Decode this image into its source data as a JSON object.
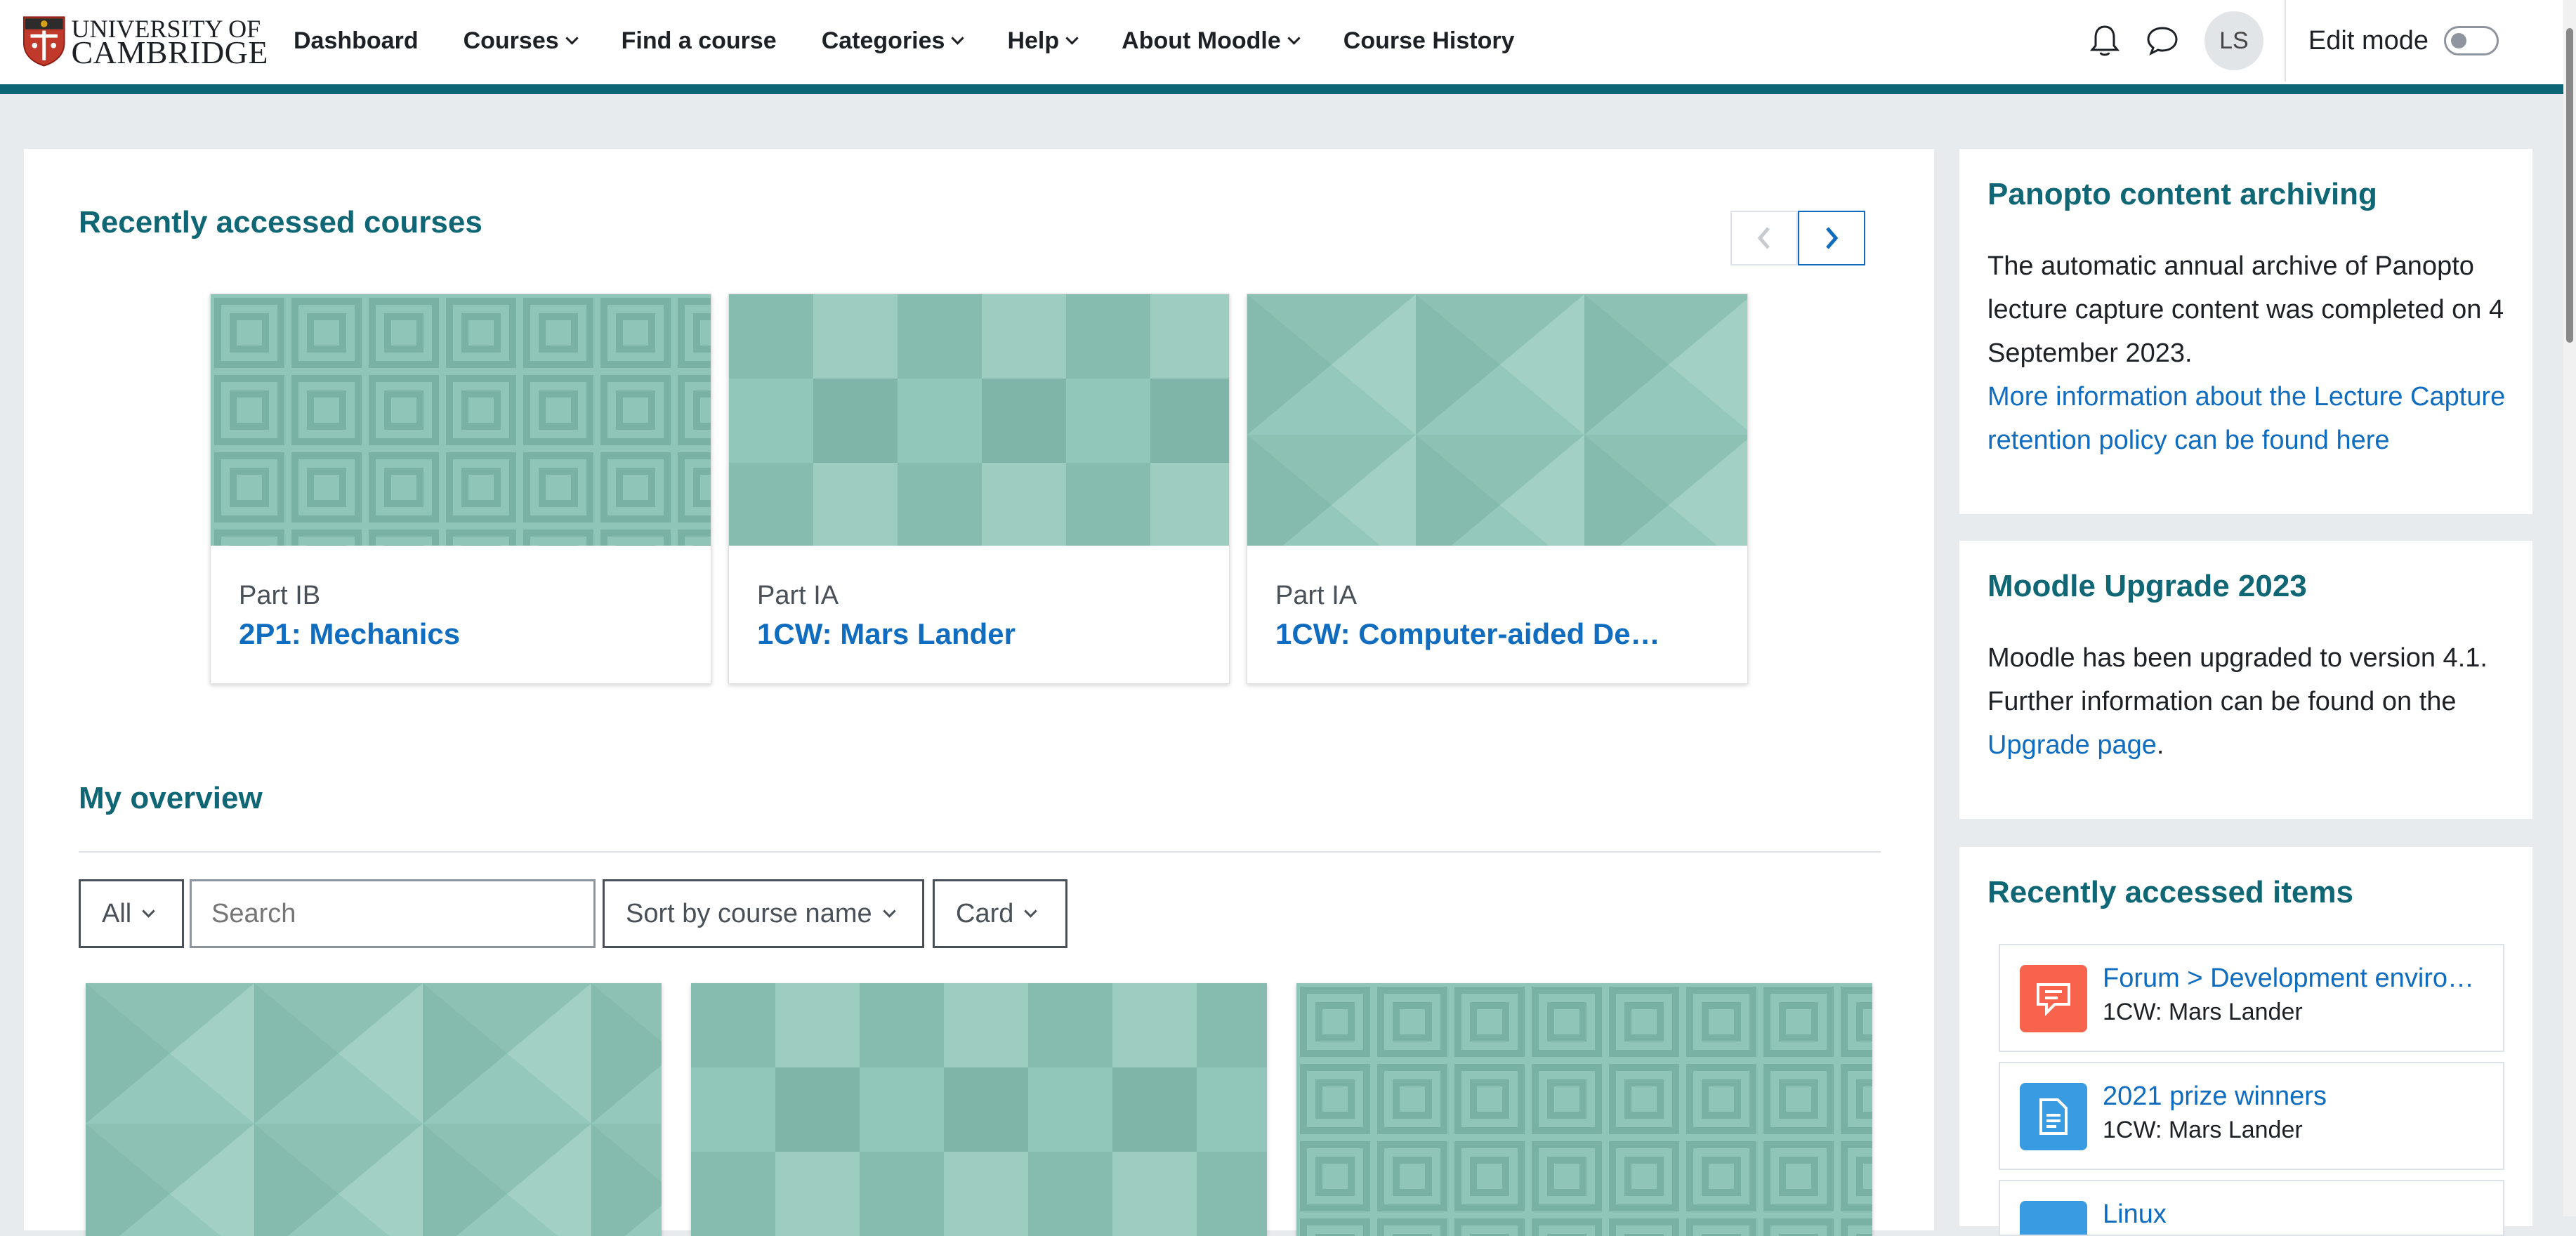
{
  "brand": {
    "line1": "UNIVERSITY OF",
    "line2": "CAMBRIDGE"
  },
  "nav": [
    {
      "label": "Dashboard",
      "dropdown": false
    },
    {
      "label": "Courses",
      "dropdown": true
    },
    {
      "label": "Find a course",
      "dropdown": false
    },
    {
      "label": "Categories",
      "dropdown": true
    },
    {
      "label": "Help",
      "dropdown": true
    },
    {
      "label": "About Moodle",
      "dropdown": true
    },
    {
      "label": "Course History",
      "dropdown": false
    }
  ],
  "user": {
    "initials": "LS"
  },
  "edit_mode": {
    "label": "Edit mode",
    "on": false
  },
  "recent_courses": {
    "title": "Recently accessed courses",
    "cards": [
      {
        "category": "Part IB",
        "name": "2P1: Mechanics",
        "pattern": "squares"
      },
      {
        "category": "Part IA",
        "name": "1CW: Mars Lander",
        "pattern": "grid"
      },
      {
        "category": "Part IA",
        "name": "1CW: Computer-aided De…",
        "pattern": "triangles"
      }
    ]
  },
  "overview": {
    "title": "My overview",
    "filter": "All",
    "search_placeholder": "Search",
    "sort": "Sort by course name",
    "view": "Card",
    "cards": [
      {
        "pattern": "triangles"
      },
      {
        "pattern": "grid"
      },
      {
        "pattern": "squares"
      }
    ]
  },
  "sidebar": {
    "panopto": {
      "title": "Panopto content archiving",
      "text": "The automatic annual archive of Panopto lecture capture content was completed on 4 September 2023.",
      "link": "More information about the Lecture Capture retention policy can be found here"
    },
    "upgrade": {
      "title": "Moodle Upgrade 2023",
      "text": "Moodle has been upgraded to version 4.1. Further information can be found on the",
      "link": "Upgrade page",
      "suffix": "."
    },
    "recent_items": {
      "title": "Recently accessed items",
      "items": [
        {
          "title": "Forum > Development enviro…",
          "course": "1CW: Mars Lander",
          "icon": "forum-icon",
          "color": "#f7634d"
        },
        {
          "title": "2021 prize winners",
          "course": "1CW: Mars Lander",
          "icon": "file-icon",
          "color": "#399be2"
        },
        {
          "title": "Linux",
          "course": "",
          "icon": "file-icon",
          "color": "#399be2"
        }
      ]
    }
  },
  "colors": {
    "accent": "#0f6674",
    "link": "#0f6cbf",
    "topbar_border": "#0d6675"
  }
}
